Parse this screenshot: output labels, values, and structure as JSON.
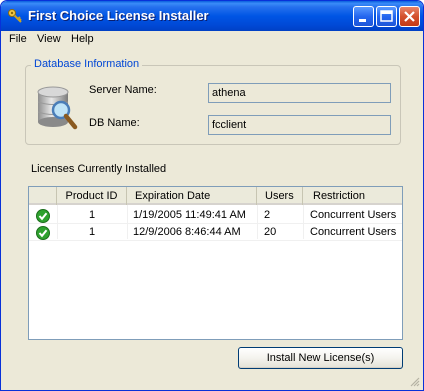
{
  "window": {
    "title": "First Choice License Installer"
  },
  "menu": [
    "File",
    "View",
    "Help"
  ],
  "database": {
    "legend": "Database Information",
    "server_label": "Server Name:",
    "server_value": "athena",
    "db_label": "DB Name:",
    "db_value": "fcclient"
  },
  "licenses": {
    "label": "Licenses Currently Installed",
    "columns": [
      "",
      "Product ID",
      "Expiration Date",
      "Users",
      "Restriction"
    ],
    "rows": [
      {
        "status_icon": "check-icon",
        "product_id": "1",
        "expiration": "1/19/2005 11:49:41 AM",
        "users": "2",
        "restriction": "Concurrent Users"
      },
      {
        "status_icon": "check-icon",
        "product_id": "1",
        "expiration": "12/9/2006 8:46:44 AM",
        "users": "20",
        "restriction": "Concurrent Users"
      }
    ]
  },
  "buttons": {
    "install": "Install New License(s)"
  },
  "colors": {
    "titlebar": "#0055e5",
    "legend": "#0046d5",
    "check": "#2ea12e",
    "window_bg": "#ece9d8"
  }
}
